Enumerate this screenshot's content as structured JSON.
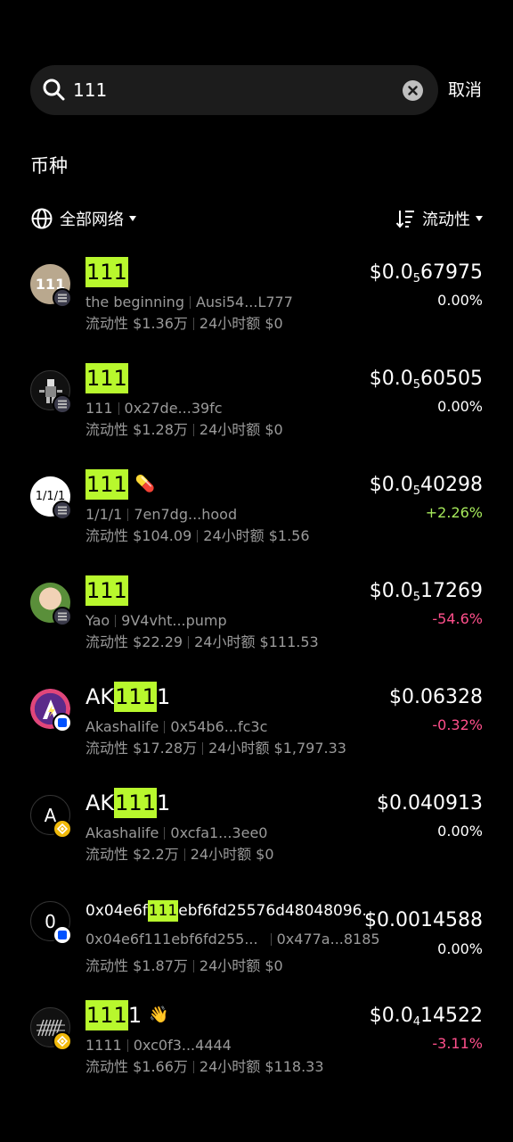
{
  "search": {
    "query": "111",
    "cancel_label": "取消"
  },
  "section_title": "币种",
  "filters": {
    "network_label": "全部网络",
    "sort_label": "流动性"
  },
  "colors": {
    "highlight": "#b8f82d",
    "up": "#a6e95b",
    "down": "#ff4f8b",
    "muted": "#9a9a9a"
  },
  "tokens": [
    {
      "name_pre": "",
      "name_hl": "111",
      "name_post": "",
      "emoji": "",
      "avatar_text": "111",
      "chain": "solana",
      "desc": "the beginning",
      "address": "Ausi54...L777",
      "liquidity": "流动性 $1.36万",
      "volume": "24小时额 $0",
      "price_pre": "$0.0",
      "price_sub": "5",
      "price_post": "67975",
      "change": "0.00%"
    },
    {
      "name_pre": "",
      "name_hl": "111",
      "name_post": "",
      "emoji": "",
      "avatar_text": "",
      "chain": "solana",
      "desc": "111",
      "address": "0x27de...39fc",
      "liquidity": "流动性 $1.28万",
      "volume": "24小时额 $0",
      "price_pre": "$0.0",
      "price_sub": "5",
      "price_post": "60505",
      "change": "0.00%"
    },
    {
      "name_pre": "",
      "name_hl": "111",
      "name_post": "",
      "emoji": "💊",
      "avatar_text": "1/1/1",
      "chain": "solana",
      "desc": "1/1/1",
      "address": "7en7dg...hood",
      "liquidity": "流动性 $104.09",
      "volume": "24小时额 $1.56",
      "price_pre": "$0.0",
      "price_sub": "5",
      "price_post": "40298",
      "change": "+2.26%"
    },
    {
      "name_pre": "",
      "name_hl": "111",
      "name_post": "",
      "emoji": "",
      "avatar_text": "",
      "chain": "solana",
      "desc": "Yao",
      "address": "9V4vht...pump",
      "liquidity": "流动性 $22.29",
      "volume": "24小时额 $111.53",
      "price_pre": "$0.0",
      "price_sub": "5",
      "price_post": "17269",
      "change": "-54.6%"
    },
    {
      "name_pre": "AK",
      "name_hl": "111",
      "name_post": "1",
      "emoji": "",
      "avatar_text": "A",
      "chain": "base",
      "desc": "Akashalife",
      "address": "0x54b6...fc3c",
      "liquidity": "流动性 $17.28万",
      "volume": "24小时额 $1,797.33",
      "price_pre": "$0.06328",
      "price_sub": "",
      "price_post": "",
      "change": "-0.32%"
    },
    {
      "name_pre": "AK",
      "name_hl": "111",
      "name_post": "1",
      "emoji": "",
      "avatar_text": "A",
      "chain": "bsc",
      "desc": "Akashalife",
      "address": "0xcfa1...3ee0",
      "liquidity": "流动性 $2.2万",
      "volume": "24小时额 $0",
      "price_pre": "$0.040913",
      "price_sub": "",
      "price_post": "",
      "change": "0.00%"
    },
    {
      "name_pre": "0x04e6f",
      "name_hl": "111",
      "name_post": "ebf6fd25576d48048096...",
      "emoji": "",
      "avatar_text": "0",
      "chain": "base",
      "desc": "0x04e6f111ebf6fd255...",
      "address": "0x477a...8185",
      "liquidity": "流动性 $1.87万",
      "volume": "24小时额 $0",
      "price_pre": "$0.0014588",
      "price_sub": "",
      "price_post": "",
      "change": "0.00%"
    },
    {
      "name_pre": "",
      "name_hl": "111",
      "name_post": "1",
      "emoji": "👋",
      "avatar_text": "1111",
      "chain": "bsc",
      "desc": "1111",
      "address": "0xc0f3...4444",
      "liquidity": "流动性 $1.66万",
      "volume": "24小时额 $118.33",
      "price_pre": "$0.0",
      "price_sub": "4",
      "price_post": "14522",
      "change": "-3.11%"
    }
  ]
}
